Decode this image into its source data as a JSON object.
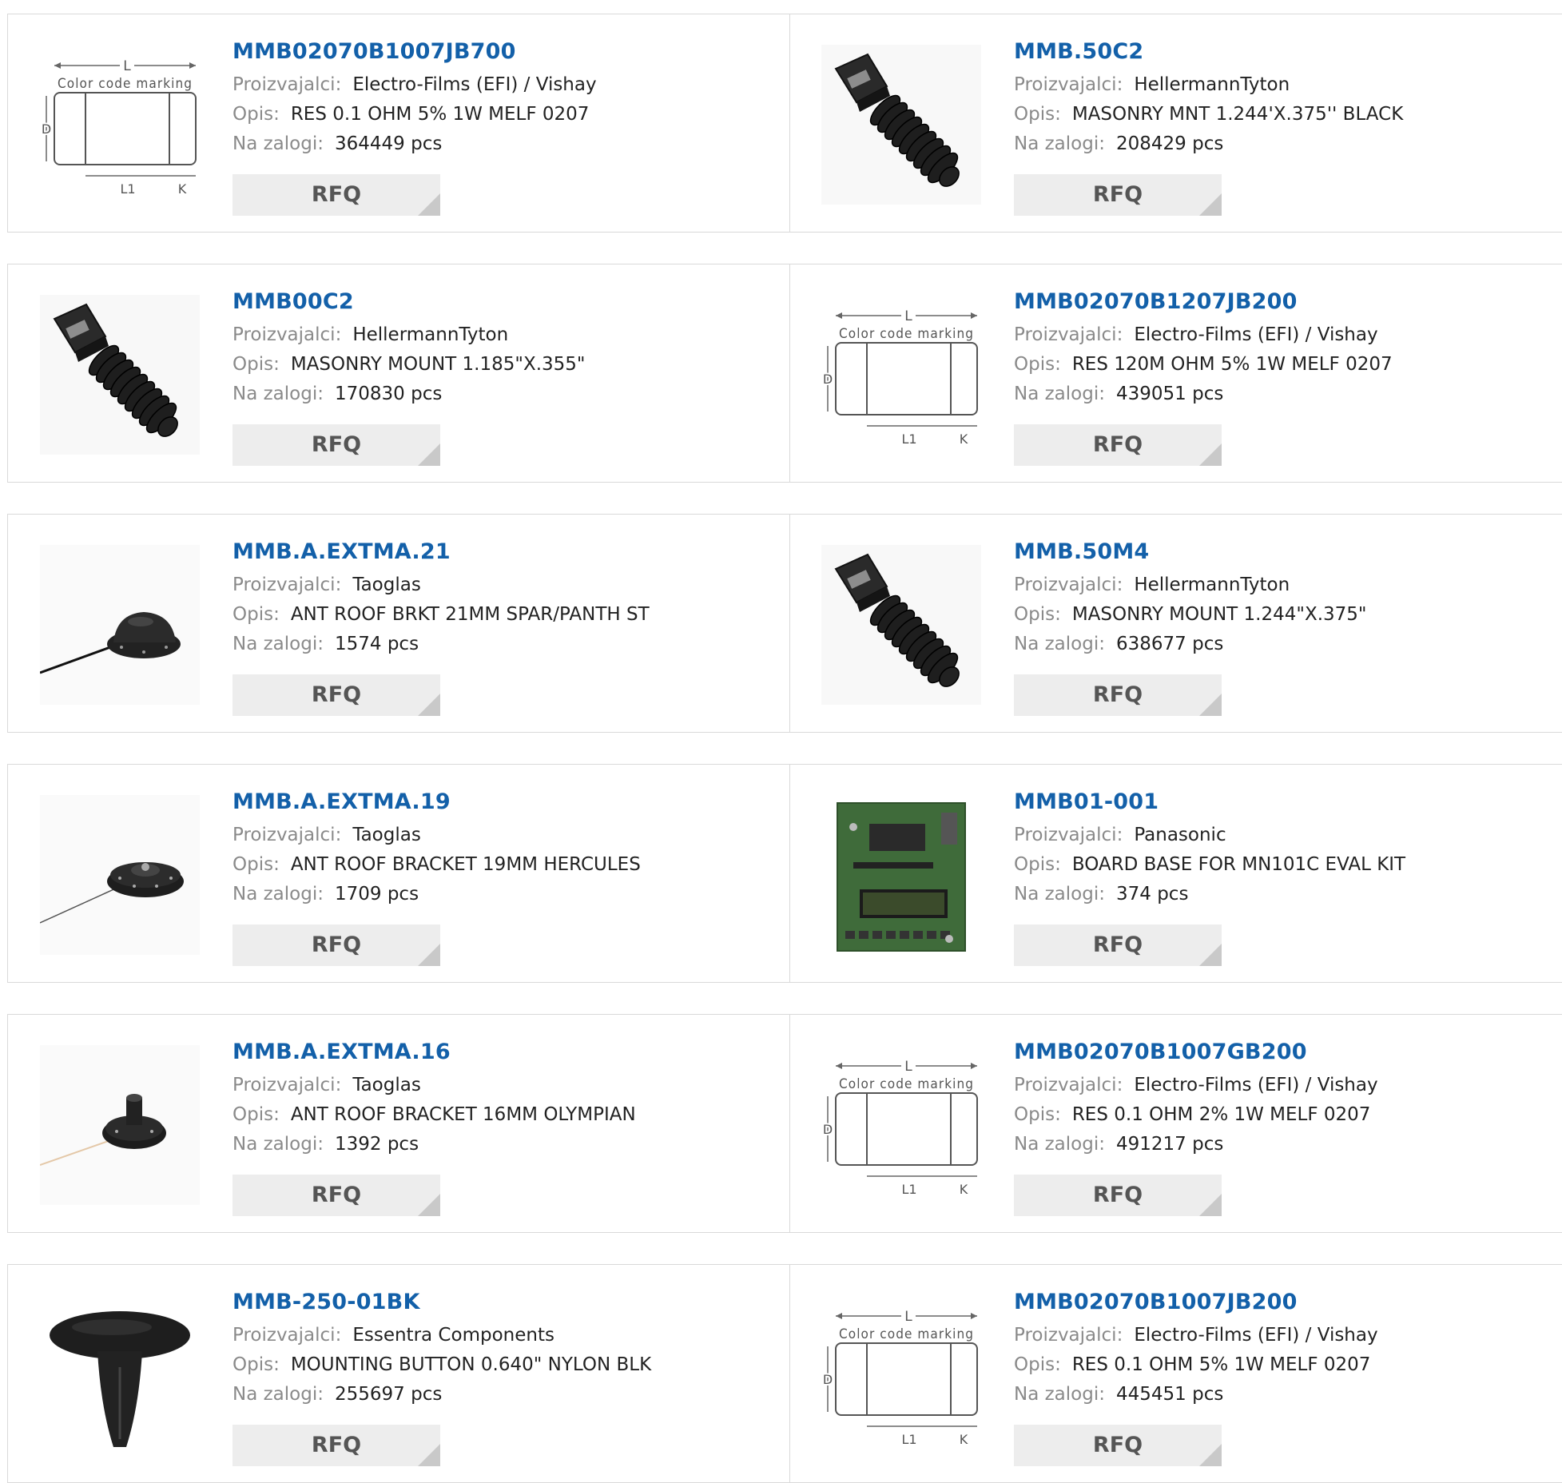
{
  "labels": {
    "manufacturer": "Proizvajalci:",
    "description": "Opis:",
    "stock": "Na zalogi:",
    "rfq": "RFQ"
  },
  "diagram": {
    "top_text": "L",
    "band_text": "Color code marking",
    "left_text": "D",
    "bottom_text": "L1",
    "right_text": "K"
  },
  "products": [
    {
      "part": "MMB02070B1007JB700",
      "manufacturer": "Electro-Films (EFI) / Vishay",
      "description": "RES 0.1 OHM 5% 1W MELF 0207",
      "stock": "364449 pcs",
      "image": "resistor-diagram"
    },
    {
      "part": "MMB.50C2",
      "manufacturer": "HellermannTyton",
      "description": "MASONRY MNT 1.244'X.375'' BLACK",
      "stock": "208429 pcs",
      "image": "masonry-mount"
    },
    {
      "part": "MMB00C2",
      "manufacturer": "HellermannTyton",
      "description": "MASONRY MOUNT 1.185\"X.355\"",
      "stock": "170830 pcs",
      "image": "masonry-mount"
    },
    {
      "part": "MMB02070B1207JB200",
      "manufacturer": "Electro-Films (EFI) / Vishay",
      "description": "RES 120M OHM 5% 1W MELF 0207",
      "stock": "439051 pcs",
      "image": "resistor-diagram"
    },
    {
      "part": "MMB.A.EXTMA.21",
      "manufacturer": "Taoglas",
      "description": "ANT ROOF BRKT 21MM SPAR/PANTH ST",
      "stock": "1574 pcs",
      "image": "antenna-dome"
    },
    {
      "part": "MMB.50M4",
      "manufacturer": "HellermannTyton",
      "description": "MASONRY MOUNT 1.244\"X.375\"",
      "stock": "638677 pcs",
      "image": "masonry-mount"
    },
    {
      "part": "MMB.A.EXTMA.19",
      "manufacturer": "Taoglas",
      "description": "ANT ROOF BRACKET 19MM HERCULES",
      "stock": "1709 pcs",
      "image": "antenna-disc"
    },
    {
      "part": "MMB01-001",
      "manufacturer": "Panasonic",
      "description": "BOARD BASE FOR MN101C EVAL KIT",
      "stock": "374 pcs",
      "image": "circuit-board"
    },
    {
      "part": "MMB.A.EXTMA.16",
      "manufacturer": "Taoglas",
      "description": "ANT ROOF BRACKET 16MM OLYMPIAN",
      "stock": "1392 pcs",
      "image": "antenna-knob"
    },
    {
      "part": "MMB02070B1007GB200",
      "manufacturer": "Electro-Films (EFI) / Vishay",
      "description": "RES 0.1 OHM 2% 1W MELF 0207",
      "stock": "491217 pcs",
      "image": "resistor-diagram"
    },
    {
      "part": "MMB-250-01BK",
      "manufacturer": "Essentra Components",
      "description": "MOUNTING BUTTON 0.640\" NYLON BLK",
      "stock": "255697 pcs",
      "image": "mounting-button"
    },
    {
      "part": "MMB02070B1007JB200",
      "manufacturer": "Electro-Films (EFI) / Vishay",
      "description": "RES 0.1 OHM 5% 1W MELF 0207",
      "stock": "445451 pcs",
      "image": "resistor-diagram"
    }
  ]
}
